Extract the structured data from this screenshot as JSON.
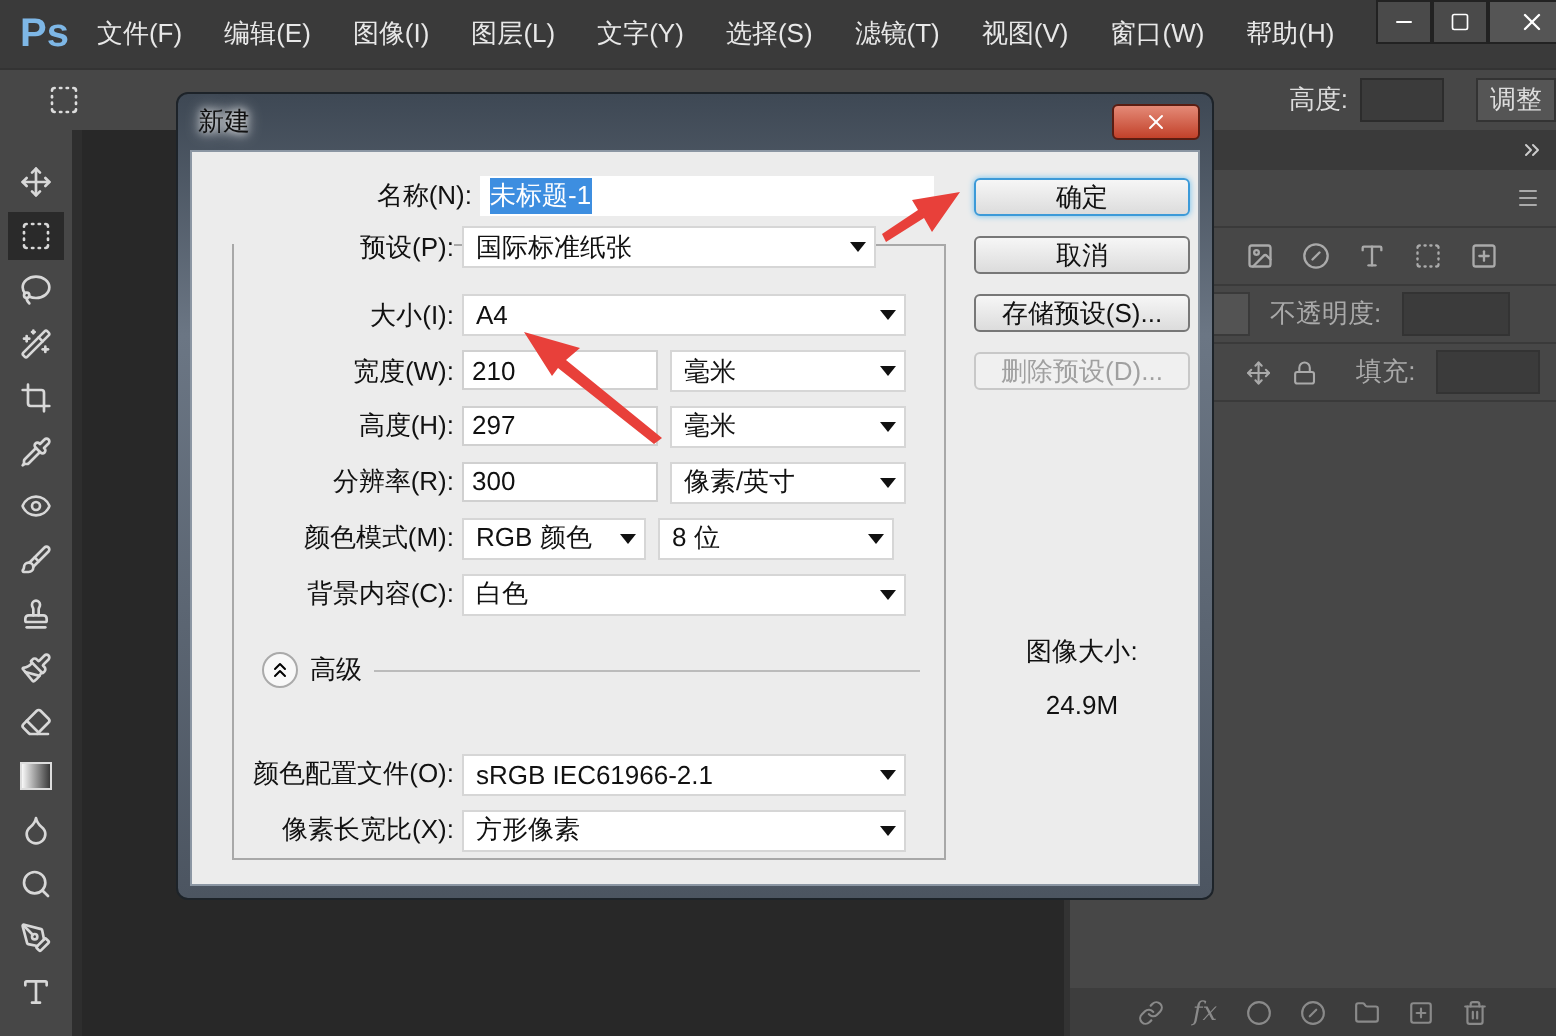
{
  "app": {
    "logo": "Ps",
    "menu": [
      "文件(F)",
      "编辑(E)",
      "图像(I)",
      "图层(L)",
      "文字(Y)",
      "选择(S)",
      "滤镜(T)",
      "视图(V)",
      "窗口(W)",
      "帮助(H)"
    ]
  },
  "options_bar": {
    "height_label": "高度:",
    "refine_button": "调整"
  },
  "tools": [
    {
      "kind": "move",
      "selected": false
    },
    {
      "kind": "marquee",
      "selected": true
    },
    {
      "kind": "lasso",
      "selected": false
    },
    {
      "kind": "wand",
      "selected": false
    },
    {
      "kind": "crop",
      "selected": false
    },
    {
      "kind": "eyedropper",
      "selected": false
    },
    {
      "kind": "heal",
      "selected": false
    },
    {
      "kind": "brush",
      "selected": false
    },
    {
      "kind": "stamp",
      "selected": false
    },
    {
      "kind": "history",
      "selected": false
    },
    {
      "kind": "eraser",
      "selected": false
    },
    {
      "kind": "gradient",
      "selected": false
    },
    {
      "kind": "blur",
      "selected": false
    },
    {
      "kind": "dodge",
      "selected": false
    },
    {
      "kind": "pen",
      "selected": false
    },
    {
      "kind": "type",
      "selected": false
    }
  ],
  "dialog": {
    "title": "新建",
    "name": {
      "label": "名称(N):",
      "value": "未标题-1",
      "selected": true
    },
    "preset": {
      "label": "预设(P):",
      "value": "国际标准纸张"
    },
    "rows": [
      {
        "label": "大小(I):",
        "controls": [
          {
            "kind": "select",
            "value": "A4"
          }
        ]
      },
      {
        "label": "宽度(W):",
        "controls": [
          {
            "kind": "input",
            "value": "210"
          },
          {
            "kind": "select",
            "value": "毫米"
          }
        ]
      },
      {
        "label": "高度(H):",
        "controls": [
          {
            "kind": "input",
            "value": "297"
          },
          {
            "kind": "select",
            "value": "毫米"
          }
        ]
      },
      {
        "label": "分辨率(R):",
        "controls": [
          {
            "kind": "input",
            "value": "300"
          },
          {
            "kind": "select",
            "value": "像素/英寸"
          }
        ]
      },
      {
        "label": "颜色模式(M):",
        "controls": [
          {
            "kind": "select",
            "value": "RGB 颜色"
          },
          {
            "kind": "select",
            "value": "8 位"
          }
        ]
      },
      {
        "label": "背景内容(C):",
        "controls": [
          {
            "kind": "select",
            "value": "白色"
          }
        ]
      }
    ],
    "advanced": {
      "label": "高级",
      "expanded": true
    },
    "advanced_rows": [
      {
        "label": "颜色配置文件(O):",
        "controls": [
          {
            "kind": "select",
            "value": "sRGB IEC61966-2.1"
          }
        ]
      },
      {
        "label": "像素长宽比(X):",
        "controls": [
          {
            "kind": "select",
            "value": "方形像素"
          }
        ]
      }
    ],
    "buttons": [
      {
        "label": "确定",
        "default": true,
        "disabled": false
      },
      {
        "label": "取消",
        "default": false,
        "disabled": false
      },
      {
        "label": "存储预设(S)...",
        "default": false,
        "disabled": false
      },
      {
        "label": "删除预设(D)...",
        "default": false,
        "disabled": true
      }
    ],
    "image_size": {
      "label": "图像大小:",
      "value": "24.9M"
    }
  },
  "layers_panel": {
    "opacity_label": "不透明度:",
    "fill_label": "填充:",
    "fx_label": "fx"
  }
}
